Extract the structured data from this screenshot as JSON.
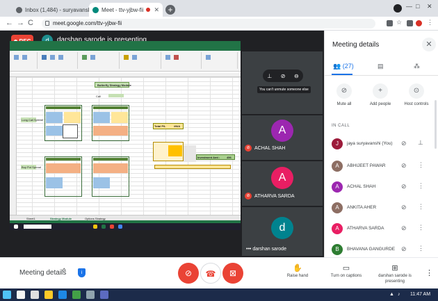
{
  "browser": {
    "tabs": [
      {
        "title": "Inbox (1,484) - suryavanshi.jaya@",
        "active": false
      },
      {
        "title": "Meet - ttv-yjbw-fii",
        "active": true
      }
    ],
    "new_tab": "+",
    "url": "meet.google.com/ttv-yjbw-fii",
    "back": "←",
    "forward": "→",
    "reload": "C",
    "window_controls": [
      "—",
      "□",
      "✕"
    ]
  },
  "meet": {
    "rec_label": "REC",
    "presenter_initial": "d",
    "presenter_banner": "darshan sarode is presenting",
    "tooltip": "You can't unmute someone else",
    "tiles": [
      {
        "name": "ACHAL SHAH",
        "initial": "A",
        "color": "#9c27b0",
        "muted": true
      },
      {
        "name": "ATHARVA SARDA",
        "initial": "A",
        "color": "#e91e63",
        "muted": true
      },
      {
        "name": "darshan sarode",
        "initial": "d",
        "color": "#00838f",
        "muted": false
      }
    ],
    "tile_more": "•••"
  },
  "excel": {
    "sheet_title": "Butterfly Strategy Module",
    "col_label_1": "Call",
    "col_label_2": "Put",
    "net_pnl_label": "Total P/L",
    "net_pnl_value": "#N/A",
    "investment_label": "Investment Amt :",
    "investment_value": "456",
    "row_label_1": "Long Call Spread",
    "row_label_2": "Buy Put Spread",
    "sheet_tabs": [
      "Sheet1",
      "Strategy Module",
      "Options Strategy"
    ]
  },
  "panel": {
    "title": "Meeting details",
    "close": "✕",
    "people_count": "(27)",
    "actions": [
      {
        "label": "Mute all",
        "icon": "mic-off-icon",
        "glyph": "🎙"
      },
      {
        "label": "Add people",
        "icon": "add-person-icon",
        "glyph": "+"
      },
      {
        "label": "Host controls",
        "icon": "toggle-icon",
        "glyph": "⊙"
      }
    ],
    "in_call": "IN CALL",
    "participants": [
      {
        "name": "jaya suryavanshi (You)",
        "initial": "J",
        "color": "#9c1b3a",
        "action": "pin"
      },
      {
        "name": "ABHIJEET PAWAR",
        "initial": "A",
        "color": "#8d6e63",
        "action": "more"
      },
      {
        "name": "ACHAL SHAH",
        "initial": "A",
        "color": "#9c27b0",
        "action": "more"
      },
      {
        "name": "ANKITA AHER",
        "initial": "A",
        "color": "#8d6e63",
        "action": "more"
      },
      {
        "name": "ATHARVA SARDA",
        "initial": "A",
        "color": "#e91e63",
        "action": "more"
      },
      {
        "name": "BHAVANA GANGURDE",
        "initial": "B",
        "color": "#2e7d32",
        "action": "more"
      }
    ]
  },
  "bottom": {
    "meeting_details": "Meeting details",
    "chevron": "^",
    "raise_hand": "Raise hand",
    "captions": "Turn on captions",
    "presenting": "darshan sarode is presenting",
    "more": "⋮"
  },
  "taskbar": {
    "time": "11:47 AM"
  }
}
